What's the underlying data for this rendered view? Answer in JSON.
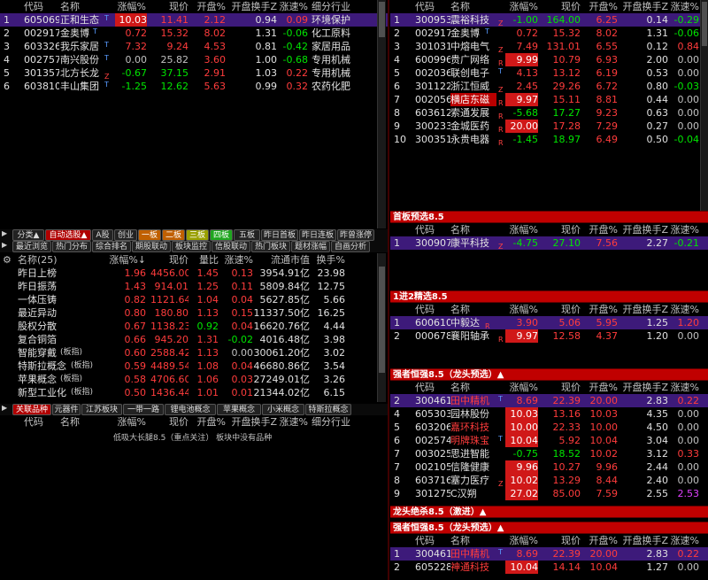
{
  "colors": {
    "accent_red": "#d01818",
    "selected": "#3d1a7a",
    "up": "#ff3c3c",
    "down": "#00e600"
  },
  "top_left": {
    "headers": {
      "code": "代码",
      "name": "名称",
      "chg": "涨幅%",
      "price": "现价",
      "open": "开盘%",
      "turnover": "开盘换手Z",
      "speed": "涨速%",
      "industry": "细分行业"
    },
    "rows": [
      {
        "idx": "1",
        "code": "605069",
        "name": "正和生态",
        "tag": "T",
        "chg": "10.03",
        "price": "11.41",
        "open": "2.12",
        "turnover": "0.94",
        "speed": "0.09",
        "industry": "环境保护"
      },
      {
        "idx": "2",
        "code": "002917",
        "name": "金奥博",
        "tag": "T",
        "chg": "0.72",
        "price": "15.32",
        "open": "8.02",
        "turnover": "1.31",
        "speed": "-0.06",
        "industry": "化工原料"
      },
      {
        "idx": "3",
        "code": "603326",
        "name": "我乐家居",
        "tag": "T",
        "chg": "7.32",
        "price": "9.24",
        "open": "4.53",
        "turnover": "0.81",
        "speed": "-0.42",
        "industry": "家居用品"
      },
      {
        "idx": "4",
        "code": "002757",
        "name": "南兴股份",
        "tag": "T",
        "chg": "0.00",
        "price": "25.82",
        "open": "3.60",
        "turnover": "1.00",
        "speed": "-0.68",
        "industry": "专用机械"
      },
      {
        "idx": "5",
        "code": "301357",
        "name": "北方长龙",
        "tag": "Z",
        "chg": "-0.67",
        "price": "37.15",
        "open": "2.91",
        "turnover": "1.03",
        "speed": "0.22",
        "industry": "专用机械"
      },
      {
        "idx": "6",
        "code": "603810",
        "name": "丰山集团",
        "tag": "T",
        "chg": "-1.25",
        "price": "12.62",
        "open": "5.63",
        "turnover": "0.99",
        "speed": "0.32",
        "industry": "农药化肥"
      }
    ]
  },
  "top_right": {
    "headers": {
      "code": "代码",
      "name": "名称",
      "chg": "涨幅%",
      "price": "现价",
      "open": "开盘%",
      "turnover": "开盘换手Z",
      "speed": "涨速%"
    },
    "rows": [
      {
        "idx": "1",
        "code": "300953",
        "name": "震裕科技",
        "tag": "Z",
        "chg": "-1.00",
        "price": "164.00",
        "open": "6.25",
        "turnover": "0.14",
        "speed": "-0.29"
      },
      {
        "idx": "2",
        "code": "002917",
        "name": "金奥博",
        "tag": "T",
        "chg": "0.72",
        "price": "15.32",
        "open": "8.02",
        "turnover": "1.31",
        "speed": "-0.06"
      },
      {
        "idx": "3",
        "code": "301031",
        "name": "中熔电气",
        "tag": "Z",
        "chg": "7.49",
        "price": "131.01",
        "open": "6.55",
        "turnover": "0.12",
        "speed": "0.84"
      },
      {
        "idx": "4",
        "code": "600996",
        "name": "贵广网络",
        "tag": "R",
        "chg": "9.99",
        "price": "10.79",
        "open": "6.93",
        "turnover": "2.00",
        "speed": "0.00"
      },
      {
        "idx": "5",
        "code": "002036",
        "name": "联创电子",
        "tag": "T",
        "chg": "4.13",
        "price": "13.12",
        "open": "6.19",
        "turnover": "0.53",
        "speed": "0.00"
      },
      {
        "idx": "6",
        "code": "301122",
        "name": "浙江恒威",
        "tag": "Z",
        "chg": "2.45",
        "price": "29.26",
        "open": "6.72",
        "turnover": "0.80",
        "speed": "-0.03"
      },
      {
        "idx": "7",
        "code": "002056",
        "name": "横店东磁",
        "tag": "R",
        "chg": "9.97",
        "price": "15.11",
        "open": "8.81",
        "turnover": "0.44",
        "speed": "0.00"
      },
      {
        "idx": "8",
        "code": "603612",
        "name": "索通发展",
        "tag": "R",
        "chg": "-5.68",
        "price": "17.27",
        "open": "9.23",
        "turnover": "0.63",
        "speed": "0.00"
      },
      {
        "idx": "9",
        "code": "300233",
        "name": "金城医药",
        "tag": "R",
        "chg": "20.00",
        "price": "17.28",
        "open": "7.29",
        "turnover": "0.27",
        "speed": "0.00"
      },
      {
        "idx": "10",
        "code": "300351",
        "name": "永贵电器",
        "tag": "R",
        "chg": "-1.45",
        "price": "18.97",
        "open": "6.49",
        "turnover": "0.50",
        "speed": "-0.04"
      }
    ]
  },
  "tabs1": [
    "分类▲",
    "自动选股▲",
    "A股",
    "创业",
    "一板",
    "二板",
    "三板",
    "四板",
    "五板",
    "昨日首板",
    "昨日连板",
    "昨曾涨停"
  ],
  "tabs2": [
    "最近浏览",
    "热门分布",
    "综合排名",
    "期股联动",
    "板块监控",
    "信股联动",
    "热门板块",
    "题材涨幅",
    "自画分析"
  ],
  "concept": {
    "headers": {
      "name": "名称(25)",
      "chg": "涨幅%↓",
      "price": "现价",
      "vol": "量比",
      "speed": "涨速%",
      "cap": "流通市值",
      "turn": "换手%"
    },
    "rows": [
      {
        "name": "昨日上榜",
        "sub": "",
        "chg": "1.96",
        "price": "4456.00",
        "vol": "1.45",
        "speed": "0.13",
        "cap": "3954.91亿",
        "turn": "23.98"
      },
      {
        "name": "昨日振荡",
        "sub": "",
        "chg": "1.43",
        "price": "914.01",
        "vol": "1.25",
        "speed": "0.11",
        "cap": "5809.84亿",
        "turn": "12.75"
      },
      {
        "name": "一体压铸",
        "sub": "",
        "chg": "0.82",
        "price": "1121.64",
        "vol": "1.04",
        "speed": "0.04",
        "cap": "5627.85亿",
        "turn": "5.66"
      },
      {
        "name": "最近异动",
        "sub": "",
        "chg": "0.80",
        "price": "180.80",
        "vol": "1.13",
        "speed": "0.15",
        "cap": "11337.50亿",
        "turn": "16.25"
      },
      {
        "name": "股权分散",
        "sub": "",
        "chg": "0.67",
        "price": "1138.23",
        "vol": "0.92",
        "speed": "0.04",
        "cap": "16620.76亿",
        "turn": "4.44"
      },
      {
        "name": "复合铜箔",
        "sub": "",
        "chg": "0.66",
        "price": "945.20",
        "vol": "1.31",
        "speed": "-0.02",
        "cap": "4016.48亿",
        "turn": "3.98"
      },
      {
        "name": "智能穿戴",
        "sub": "(板指)",
        "chg": "0.60",
        "price": "2588.42",
        "vol": "1.13",
        "speed": "0.00",
        "cap": "30061.20亿",
        "turn": "3.02"
      },
      {
        "name": "特斯拉概念",
        "sub": "(板指)",
        "chg": "0.59",
        "price": "4489.54",
        "vol": "1.08",
        "speed": "0.04",
        "cap": "46680.86亿",
        "turn": "3.54"
      },
      {
        "name": "苹果概念",
        "sub": "(板指)",
        "chg": "0.58",
        "price": "4706.60",
        "vol": "1.06",
        "speed": "0.03",
        "cap": "27249.01亿",
        "turn": "3.26"
      },
      {
        "name": "新型工业化",
        "sub": "(板指)",
        "chg": "0.50",
        "price": "1436.44",
        "vol": "1.01",
        "speed": "0.01",
        "cap": "21344.02亿",
        "turn": "6.15"
      }
    ]
  },
  "tabs3": [
    "关联品种",
    "元器件",
    "江苏板块",
    "一带一路",
    "锂电池概念",
    "苹果概念",
    "小米概念",
    "特斯拉概念"
  ],
  "related": {
    "headers": {
      "code": "代码",
      "name": "名称",
      "chg": "涨幅%",
      "price": "现价",
      "open": "开盘%",
      "turnover": "开盘换手Z",
      "speed": "涨速%",
      "industry": "细分行业"
    },
    "empty_msg": "低吸大长腿8.5（重点关注） 板块中没有品种"
  },
  "sec1": {
    "title": "首板预选8.5",
    "headers": {
      "code": "代码",
      "name": "名称",
      "chg": "涨幅%",
      "price": "现价",
      "open": "开盘%",
      "turnover": "开盘换手Z",
      "speed": "涨速%"
    },
    "rows": [
      {
        "idx": "1",
        "code": "300907",
        "name": "康平科技",
        "tag": "Z",
        "chg": "-4.75",
        "price": "27.10",
        "open": "7.56",
        "turnover": "2.27",
        "speed": "-0.21"
      }
    ]
  },
  "sec2": {
    "title": "1进2精选8.5",
    "headers": {
      "code": "代码",
      "name": "名称",
      "chg": "涨幅%",
      "price": "现价",
      "open": "开盘%",
      "turnover": "开盘换手Z",
      "speed": "涨速%"
    },
    "rows": [
      {
        "idx": "1",
        "code": "600610",
        "name": "中毅达",
        "tag": "R",
        "chg": "3.90",
        "price": "5.06",
        "open": "5.95",
        "turnover": "1.25",
        "speed": "1.20"
      },
      {
        "idx": "2",
        "code": "000678",
        "name": "襄阳轴承",
        "tag": "R",
        "chg": "9.97",
        "price": "12.58",
        "open": "4.37",
        "turnover": "1.20",
        "speed": "0.00"
      }
    ]
  },
  "sec3": {
    "title": "强者恒强8.5（龙头预选）▲",
    "headers": {
      "code": "代码",
      "name": "名称",
      "chg": "涨幅%",
      "price": "现价",
      "open": "开盘%",
      "turnover": "开盘换手Z",
      "speed": "涨速%"
    },
    "rows": [
      {
        "idx": "2",
        "code": "300461",
        "name": "田中精机",
        "tag": "T",
        "chg": "8.69",
        "price": "22.39",
        "open": "20.00",
        "turnover": "2.83",
        "speed": "0.22"
      },
      {
        "idx": "4",
        "code": "605303",
        "name": "园林股份",
        "tag": "",
        "chg": "10.03",
        "price": "13.16",
        "open": "10.03",
        "turnover": "4.35",
        "speed": "0.00"
      },
      {
        "idx": "5",
        "code": "603206",
        "name": "嘉环科技",
        "tag": "",
        "chg": "10.00",
        "price": "22.33",
        "open": "10.00",
        "turnover": "4.50",
        "speed": "0.00"
      },
      {
        "idx": "6",
        "code": "002574",
        "name": "明牌珠宝",
        "tag": "T",
        "chg": "10.04",
        "price": "5.92",
        "open": "10.04",
        "turnover": "3.04",
        "speed": "0.00"
      },
      {
        "idx": "7",
        "code": "003025",
        "name": "思进智能",
        "tag": "",
        "chg": "-0.75",
        "price": "18.52",
        "open": "10.02",
        "turnover": "3.12",
        "speed": "0.33"
      },
      {
        "idx": "7",
        "code": "002105",
        "name": "信隆健康",
        "tag": "",
        "chg": "9.96",
        "price": "10.27",
        "open": "9.96",
        "turnover": "2.44",
        "speed": "0.00"
      },
      {
        "idx": "8",
        "code": "603716",
        "name": "塞力医疗",
        "tag": "Z",
        "chg": "10.02",
        "price": "13.29",
        "open": "8.44",
        "turnover": "2.40",
        "speed": "0.00"
      },
      {
        "idx": "9",
        "code": "301275",
        "name": "C汉朔",
        "tag": "",
        "chg": "27.02",
        "price": "85.00",
        "open": "7.59",
        "turnover": "2.55",
        "speed": "2.53"
      }
    ]
  },
  "sec4": {
    "title": "龙头绝杀8.5（激进）▲"
  },
  "sec5": {
    "title": "强者恒强8.5（龙头预选）▲",
    "headers": {
      "code": "代码",
      "name": "名称",
      "chg": "涨幅%",
      "price": "现价",
      "open": "开盘%",
      "turnover": "开盘换手Z",
      "speed": "涨速%"
    },
    "rows": [
      {
        "idx": "1",
        "code": "300461",
        "name": "田中精机",
        "tag": "T",
        "chg": "8.69",
        "price": "22.39",
        "open": "20.00",
        "turnover": "2.83",
        "speed": "0.22"
      },
      {
        "idx": "2",
        "code": "605228",
        "name": "神通科技",
        "tag": "",
        "chg": "10.04",
        "price": "14.14",
        "open": "10.04",
        "turnover": "1.27",
        "speed": "0.00"
      }
    ]
  }
}
